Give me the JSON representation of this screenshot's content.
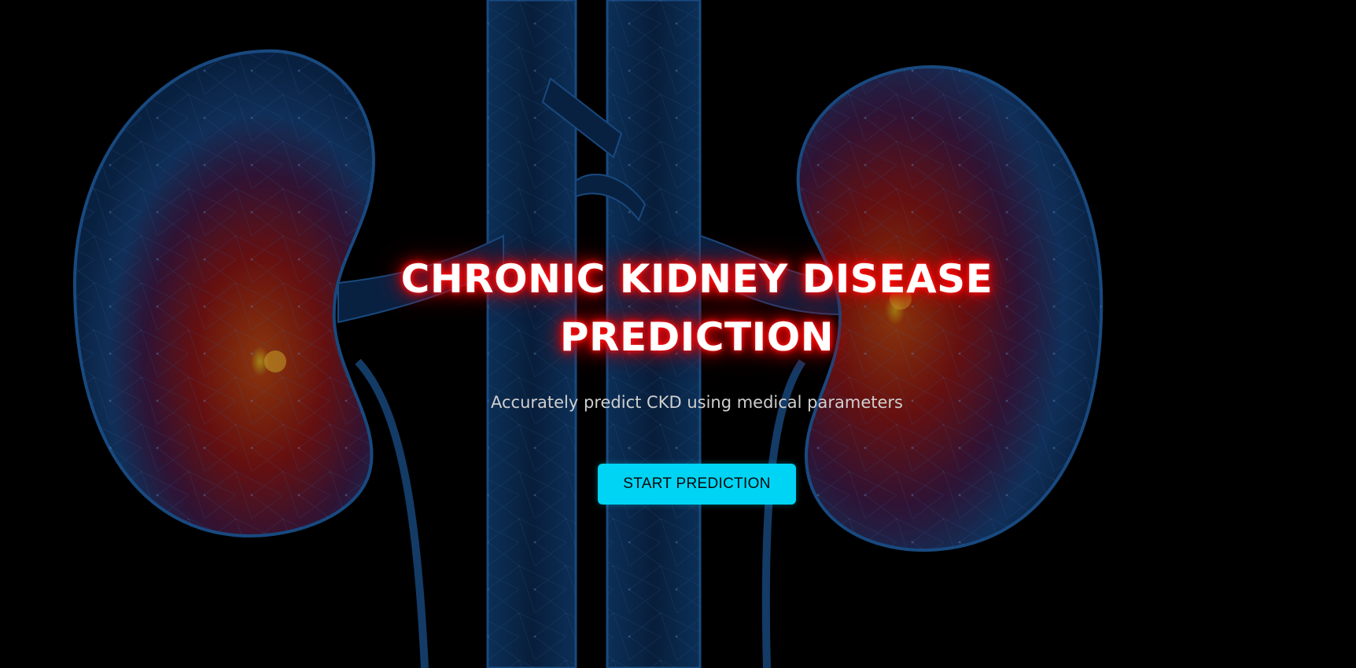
{
  "hero": {
    "title_line1": "CHRONIC KIDNEY DISEASE",
    "title_line2": "PREDICTION",
    "subtitle": "Accurately predict CKD using medical parameters",
    "cta_label": "START PREDICTION"
  },
  "colors": {
    "background": "#000000",
    "title_text": "#ffffff",
    "title_glow": "#ff0000",
    "subtitle_text": "#cfcfcf",
    "button_bg": "#00d4f5",
    "button_text": "#0a0a0a",
    "organ_outline": "#1e5a9c",
    "organ_core": "#8a1414"
  },
  "icons": {
    "left_organ": "kidney-left-illustration",
    "right_organ": "kidney-right-illustration",
    "vessels": "blood-vessel-illustration"
  }
}
